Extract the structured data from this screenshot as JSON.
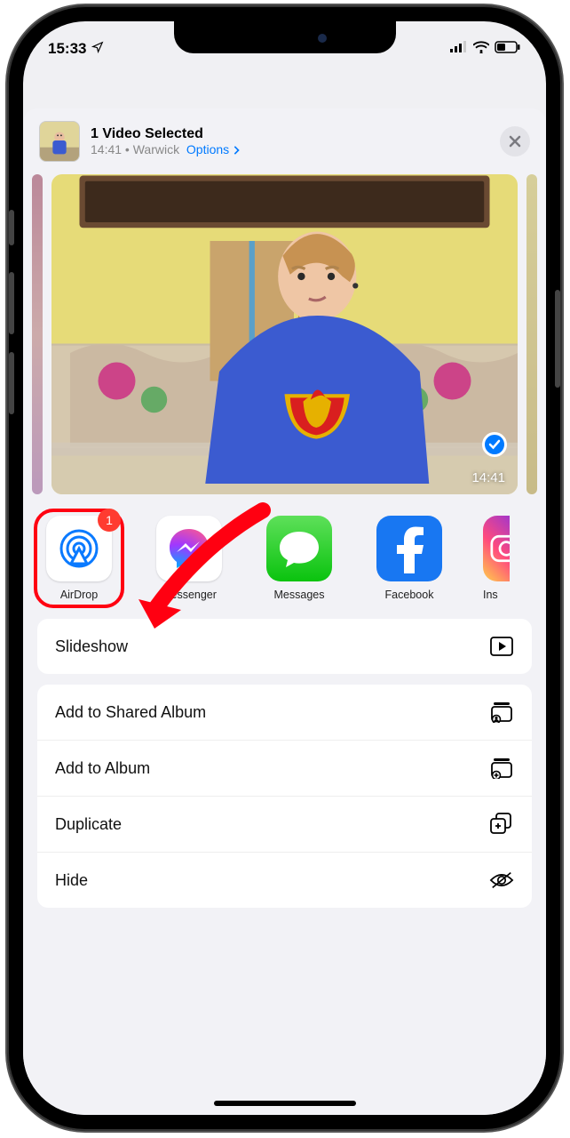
{
  "status": {
    "time": "15:33"
  },
  "header": {
    "title": "1 Video Selected",
    "time": "14:41",
    "separator": " • ",
    "location": "Warwick",
    "options": "Options"
  },
  "preview": {
    "duration": "14:41"
  },
  "apps": {
    "airdrop": {
      "label": "AirDrop",
      "badge": "1"
    },
    "messenger": {
      "label": "Messenger"
    },
    "messages": {
      "label": "Messages"
    },
    "facebook": {
      "label": "Facebook"
    },
    "instagram": {
      "label": "Ins"
    }
  },
  "actions": {
    "slideshow": "Slideshow",
    "addShared": "Add to Shared Album",
    "addAlbum": "Add to Album",
    "duplicate": "Duplicate",
    "hide": "Hide"
  }
}
